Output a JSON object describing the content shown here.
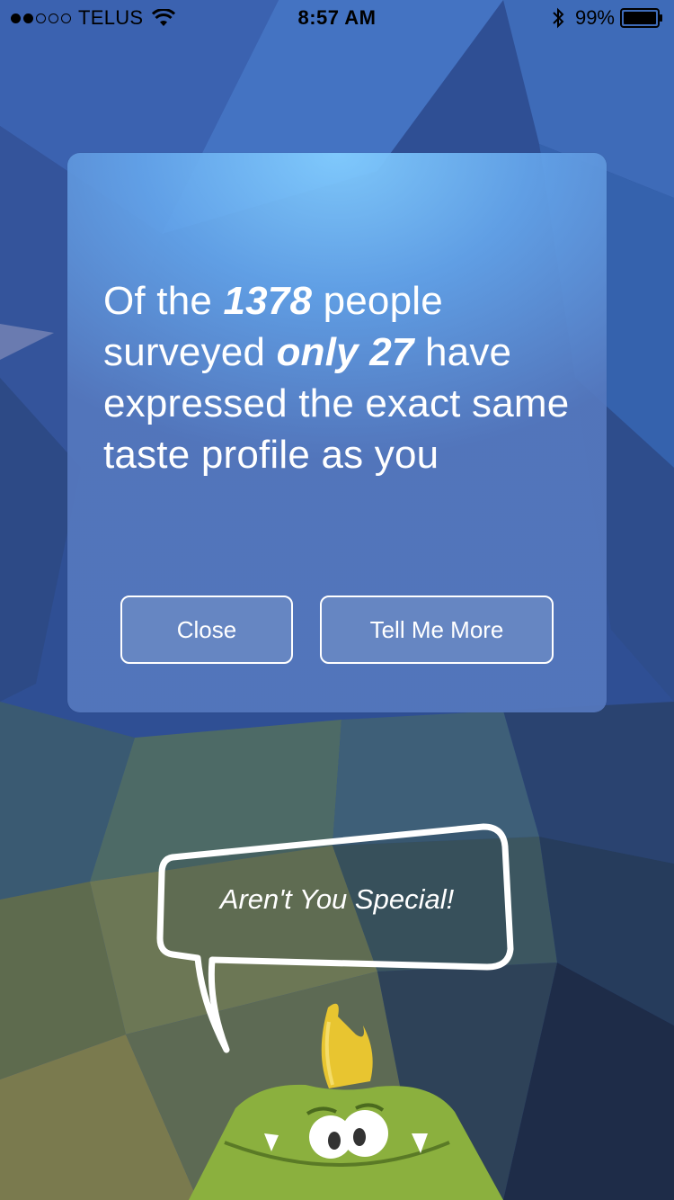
{
  "status_bar": {
    "carrier": "TELUS",
    "time": "8:57 AM",
    "battery_percent": "99%",
    "signal_bars_filled": 2,
    "signal_bars_total": 5
  },
  "dialog": {
    "message_part1": "Of the ",
    "surveyed_count": "1378",
    "message_part2": " people surveyed ",
    "only_count": "only 27",
    "message_part3": " have expressed the exact same taste profile as you",
    "close_label": "Close",
    "more_label": "Tell Me More"
  },
  "speech_bubble": {
    "text": "Aren't You Special!"
  },
  "icons": {
    "wifi": "wifi-icon",
    "bluetooth": "bluetooth-icon",
    "battery": "battery-icon",
    "mascot": "green-monster-mascot"
  },
  "colors": {
    "card_top": "#82cdff",
    "card_bottom": "#5578be",
    "mascot_green": "#8bb03e",
    "mascot_horn": "#e8c530"
  }
}
